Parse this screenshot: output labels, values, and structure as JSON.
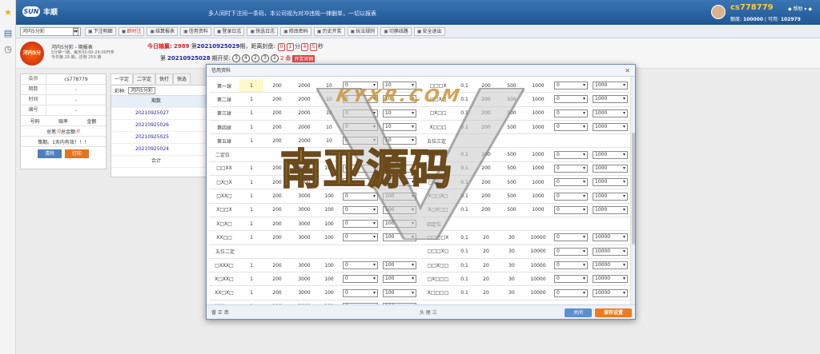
{
  "sidebar": {
    "icons": [
      "star-icon",
      "book-icon",
      "clock-icon"
    ]
  },
  "header": {
    "logo_mark": "SUN",
    "brand": "丰顺",
    "notice": "多人同时下注同一条码，本公司视为对冲违规一律删单，一切以报表",
    "user": {
      "name": "cs778779",
      "balance_label": "额度:",
      "balance": "100000",
      "usable_label": "可用:",
      "usable": "102979",
      "controls": "◆ 帮助 ▾ ◆"
    }
  },
  "toolbar": {
    "lottery_select": "河内5分彩",
    "buttons": [
      "下注明细",
      "即时注",
      "结算报表",
      "信用资料",
      "登录日志",
      "快选日志",
      "修改密码",
      "历史开奖",
      "玩法规则",
      "切换线路",
      "安全退出"
    ]
  },
  "lottery": {
    "badge": "河内5分",
    "title": "河内5分彩 - 期报表",
    "sub1": "5分钟一期，每天00:00-24:00开奖",
    "sub2": "今日第 29 期，还剩 259 期",
    "today_label": "今日输赢:",
    "today_value": "2989",
    "issue_prefix": "第",
    "issue": "20210925029",
    "issue_suffix": "期，距离封盘:",
    "countdown": [
      "0",
      "1",
      "4",
      "5"
    ],
    "cd_sep1": "分",
    "cd_sep2": "秒",
    "prev_prefix": "第",
    "prev_issue": "20210925028",
    "prev_suffix": "期开奖:",
    "balls": [
      "3",
      "4",
      "2",
      "3",
      "2"
    ],
    "sum": "2",
    "sum_suffix": "番",
    "open_btn": "开奖官网"
  },
  "member_panel": {
    "rows": [
      {
        "k": "会员",
        "v": "cs778779"
      },
      {
        "k": "期数",
        "v": "-"
      },
      {
        "k": "时间",
        "v": "-"
      },
      {
        "k": "编号",
        "v": "-"
      }
    ],
    "headers": [
      "号码",
      "赔率",
      "金额"
    ],
    "total_label": "总笔: ",
    "total_count": "0",
    "total_amount_label": " 总金额: ",
    "total_amount": "0",
    "policy": "策期。1天内有效！！！",
    "clear": "清除",
    "print": "打印"
  },
  "quick_tabs": [
    "一字定",
    "二字定",
    "快打",
    "快选"
  ],
  "draw_list": {
    "filter_label": "彩种:",
    "filter_value": "河内5分彩",
    "header": "期数",
    "rows": [
      "20210925027",
      "20210925026",
      "20210925025",
      "20210925024"
    ],
    "total_label": "合计"
  },
  "modal": {
    "title": "信用资料",
    "close_glyph": "✕",
    "close_btn": "关闭",
    "save_btn": "保存设置",
    "foot_left": "番 正 串",
    "foot_right": "头 尾 三",
    "left_rows": [
      {
        "type": "data",
        "name": "第一球",
        "a": "1",
        "b": "200",
        "c": "2000",
        "d": "10",
        "s1": "0",
        "s2": "10",
        "hl": true
      },
      {
        "type": "data",
        "name": "第二球",
        "a": "1",
        "b": "200",
        "c": "2000",
        "d": "10",
        "s1": "0",
        "s2": "10"
      },
      {
        "type": "data",
        "name": "第三球",
        "a": "1",
        "b": "200",
        "c": "2000",
        "d": "10",
        "s1": "0",
        "s2": "10"
      },
      {
        "type": "data",
        "name": "第四球",
        "a": "1",
        "b": "200",
        "c": "2000",
        "d": "10",
        "s1": "0",
        "s2": "10"
      },
      {
        "type": "data",
        "name": "第五球",
        "a": "1",
        "b": "200",
        "c": "2000",
        "d": "10",
        "s1": "0",
        "s2": "10"
      },
      {
        "type": "sec",
        "name": "二定位"
      },
      {
        "type": "data",
        "name": "□□XX",
        "a": "1",
        "b": "200",
        "c": "3000",
        "d": "100",
        "s1": "0",
        "s2": "100"
      },
      {
        "type": "data",
        "name": "□X□X",
        "a": "1",
        "b": "200",
        "c": "3000",
        "d": "100",
        "s1": "0",
        "s2": "100"
      },
      {
        "type": "data",
        "name": "□XX□",
        "a": "1",
        "b": "200",
        "c": "3000",
        "d": "100",
        "s1": "0",
        "s2": "100"
      },
      {
        "type": "data",
        "name": "X□□X",
        "a": "1",
        "b": "200",
        "c": "3000",
        "d": "100",
        "s1": "0",
        "s2": "100"
      },
      {
        "type": "data",
        "name": "X□X□",
        "a": "1",
        "b": "200",
        "c": "3000",
        "d": "100",
        "s1": "0",
        "s2": "100"
      },
      {
        "type": "data",
        "name": "XX□□",
        "a": "1",
        "b": "200",
        "c": "3000",
        "d": "100",
        "s1": "0",
        "s2": "100"
      },
      {
        "type": "sec",
        "name": "五位二定"
      },
      {
        "type": "data",
        "name": "□XXX□",
        "a": "1",
        "b": "200",
        "c": "3000",
        "d": "100",
        "s1": "0",
        "s2": "100"
      },
      {
        "type": "data",
        "name": "X□XX□",
        "a": "1",
        "b": "200",
        "c": "3000",
        "d": "100",
        "s1": "0",
        "s2": "100"
      },
      {
        "type": "data",
        "name": "XX□X□",
        "a": "1",
        "b": "200",
        "c": "3000",
        "d": "100",
        "s1": "0",
        "s2": "100"
      },
      {
        "type": "data",
        "name": "XXX□□",
        "a": "1",
        "b": "200",
        "c": "3000",
        "d": "100",
        "s1": "0",
        "s2": "100"
      }
    ],
    "right_rows": [
      {
        "type": "data",
        "name": "□□□X",
        "a": "0.1",
        "b": "200",
        "c": "500",
        "d": "1000",
        "s1": "0",
        "s2": "1000"
      },
      {
        "type": "data",
        "name": "□□X□",
        "a": "0.1",
        "b": "200",
        "c": "500",
        "d": "1000",
        "s1": "0",
        "s2": "1000"
      },
      {
        "type": "data",
        "name": "□X□□",
        "a": "0.1",
        "b": "200",
        "c": "500",
        "d": "1000",
        "s1": "0",
        "s2": "1000"
      },
      {
        "type": "data",
        "name": "X□□□",
        "a": "0.1",
        "b": "200",
        "c": "500",
        "d": "1000",
        "s1": "0",
        "s2": "1000"
      },
      {
        "type": "sec",
        "name": "五位三定"
      },
      {
        "type": "data",
        "name": "□□XX□",
        "a": "0.1",
        "b": "200",
        "c": "500",
        "d": "1000",
        "s1": "0",
        "s2": "1000"
      },
      {
        "type": "data",
        "name": "□X□X□",
        "a": "0.1",
        "b": "200",
        "c": "500",
        "d": "1000",
        "s1": "0",
        "s2": "1000"
      },
      {
        "type": "data",
        "name": "□XX□□",
        "a": "0.1",
        "b": "200",
        "c": "500",
        "d": "1000",
        "s1": "0",
        "s2": "1000"
      },
      {
        "type": "data",
        "name": "X□□X□",
        "a": "0.1",
        "b": "200",
        "c": "500",
        "d": "1000",
        "s1": "0",
        "s2": "1000"
      },
      {
        "type": "data",
        "name": "X□X□□",
        "a": "0.1",
        "b": "200",
        "c": "500",
        "d": "1000",
        "s1": "0",
        "s2": "1000"
      },
      {
        "type": "sec",
        "name": "四定位"
      },
      {
        "type": "data",
        "name": "□□□□X",
        "a": "0.1",
        "b": "20",
        "c": "30",
        "d": "10000",
        "s1": "0",
        "s2": "10000"
      },
      {
        "type": "data",
        "name": "□□□X□",
        "a": "0.1",
        "b": "20",
        "c": "30",
        "d": "10000",
        "s1": "0",
        "s2": "10000"
      },
      {
        "type": "data",
        "name": "□□X□□",
        "a": "0.1",
        "b": "20",
        "c": "30",
        "d": "10000",
        "s1": "0",
        "s2": "10000"
      },
      {
        "type": "data",
        "name": "□X□□□",
        "a": "0.1",
        "b": "20",
        "c": "30",
        "d": "10000",
        "s1": "0",
        "s2": "10000"
      },
      {
        "type": "data",
        "name": "X□□□□",
        "a": "0.1",
        "b": "20",
        "c": "30",
        "d": "10000",
        "s1": "0",
        "s2": "10000"
      }
    ]
  },
  "watermark": {
    "line1": "KYXR.COM",
    "line2": "南亚源码"
  }
}
